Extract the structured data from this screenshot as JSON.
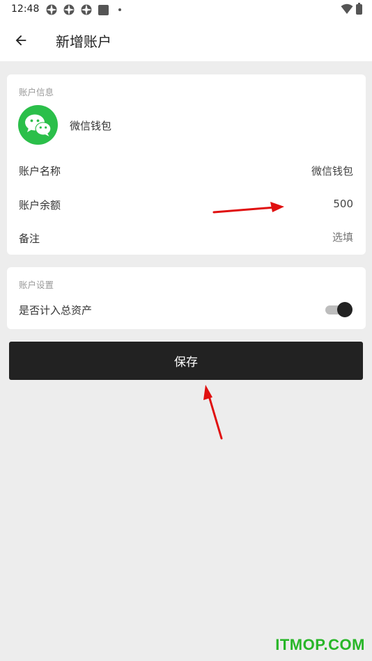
{
  "status_bar": {
    "time": "12:48"
  },
  "app_bar": {
    "title": "新增账户"
  },
  "account_info": {
    "section_label": "账户信息",
    "wallet_name": "微信钱包",
    "rows": [
      {
        "label": "账户名称",
        "value": "微信钱包"
      },
      {
        "label": "账户余额",
        "value": "500"
      },
      {
        "label": "备注",
        "placeholder": "选填"
      }
    ]
  },
  "account_settings": {
    "section_label": "账户设置",
    "include_total_label": "是否计入总资产",
    "include_total_on": true
  },
  "save_button": {
    "label": "保存"
  },
  "watermark": "ITMOP.COM",
  "colors": {
    "wechat_green": "#2bbf4a",
    "button_dark": "#222222",
    "page_bg": "#ededed",
    "annotation_red": "#e01010",
    "watermark_green": "#28b628"
  }
}
